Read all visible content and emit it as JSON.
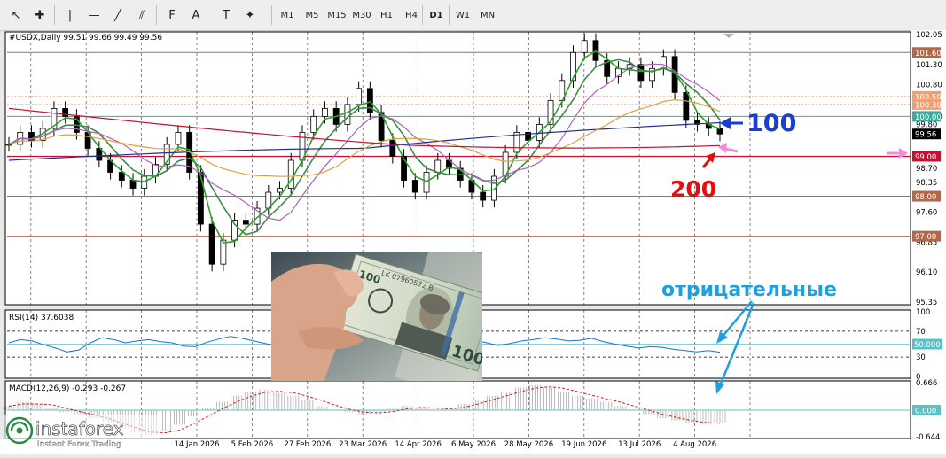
{
  "toolbar": {
    "tools": [
      {
        "name": "cursor-icon",
        "glyph": "↖"
      },
      {
        "name": "crosshair-icon",
        "glyph": "✚"
      },
      {
        "name": "vertical-line-icon",
        "glyph": "|"
      },
      {
        "name": "horizontal-line-icon",
        "glyph": "—"
      },
      {
        "name": "trendline-icon",
        "glyph": "╱"
      },
      {
        "name": "equidistant-channel-icon",
        "glyph": "⫽"
      },
      {
        "name": "fibonacci-icon",
        "glyph": "F"
      },
      {
        "name": "text-icon",
        "glyph": "A"
      },
      {
        "name": "text-label-icon",
        "glyph": "T"
      },
      {
        "name": "shapes-icon",
        "glyph": "✦"
      }
    ],
    "timeframes": [
      "M1",
      "M5",
      "M15",
      "M30",
      "H1",
      "H4",
      "D1",
      "W1",
      "MN"
    ]
  },
  "symbol_info": "#USDX,Daily  99.51 99.66 99.49 99.56",
  "rsi_title": "RSI(14) 37.6038",
  "macd_title": "MACD(12,26,9) -0.293 -0.267",
  "annotations": {
    "ma100": "100",
    "ma200": "200",
    "negative": "отрицательные"
  },
  "photo": {
    "bill_serial": "LK 07960572 B",
    "bill_denomination": "100"
  },
  "logo": {
    "name": "instaforex",
    "tagline": "Instant Forex Trading"
  },
  "chart_data": {
    "type": "line",
    "symbol": "#USDX",
    "timeframe": "Daily",
    "ohlc": {
      "open": 99.51,
      "high": 99.66,
      "low": 99.49,
      "close": 99.56
    },
    "ylim": [
      95.35,
      102.05
    ],
    "y_tick_labels": [
      "102.05",
      "101.30",
      "100.80",
      "100.00",
      "99.80",
      "98.70",
      "98.35",
      "97.60",
      "96.85",
      "96.10",
      "95.35"
    ],
    "price_badges": [
      {
        "label": "101.60",
        "value": 101.6,
        "color": "#b06848"
      },
      {
        "label": "100.50",
        "value": 100.5,
        "color": "#f0a070"
      },
      {
        "label": "100.30",
        "value": 100.3,
        "color": "#f0a070"
      },
      {
        "label": "100.00",
        "value": 100.0,
        "color": "#3caa9c"
      },
      {
        "label": "99.56",
        "value": 99.56,
        "color": "#000000"
      },
      {
        "label": "99.00",
        "value": 99.0,
        "color": "#c81030"
      },
      {
        "label": "98.00",
        "value": 98.0,
        "color": "#b06848"
      },
      {
        "label": "97.00",
        "value": 97.0,
        "color": "#b06848"
      }
    ],
    "x_tick_labels": [
      "14 Jan 2026",
      "5 Feb 2026",
      "27 Feb 2026",
      "23 Mar 2026",
      "14 Apr 2026",
      "6 May 2026",
      "28 May 2026",
      "19 Jun 2026",
      "13 Jul 2026",
      "4 Aug 2026"
    ],
    "price_series": [
      99.3,
      99.6,
      99.4,
      99.7,
      100.2,
      100.0,
      99.6,
      99.2,
      98.9,
      98.6,
      98.4,
      98.2,
      98.5,
      98.8,
      99.3,
      99.6,
      98.6,
      97.3,
      96.3,
      96.9,
      97.4,
      97.3,
      97.7,
      98.1,
      98.2,
      98.9,
      99.6,
      100.0,
      100.2,
      99.8,
      100.3,
      100.7,
      100.1,
      99.4,
      99.0,
      98.4,
      98.1,
      98.6,
      98.9,
      98.7,
      98.4,
      98.1,
      97.9,
      98.5,
      99.1,
      99.6,
      99.4,
      99.8,
      100.4,
      100.9,
      101.6,
      101.9,
      101.4,
      101.0,
      101.2,
      101.3,
      100.9,
      101.2,
      101.5,
      100.6,
      99.9,
      99.8,
      99.7,
      99.56
    ],
    "series": [
      {
        "name": "",
        "color": "#2ca02c",
        "period": 10
      },
      {
        "name": "",
        "color": "#3f8a4a",
        "period": 20
      },
      {
        "name": "",
        "color": "#b060c0",
        "period": 30
      },
      {
        "name": "",
        "color": "#1f2f8f",
        "period": 100
      },
      {
        "name": "",
        "color": "#e0a040",
        "period": 50
      },
      {
        "name": "",
        "color": "#c81030",
        "period": 200
      }
    ],
    "rsi": {
      "period": 14,
      "value": 37.6038,
      "ylim": [
        0,
        100
      ],
      "levels": [
        70,
        50,
        30
      ],
      "tick_labels": [
        "100",
        "70",
        "50.000",
        "30",
        "0"
      ],
      "series": [
        52,
        57,
        55,
        49,
        44,
        38,
        41,
        52,
        60,
        57,
        52,
        55,
        57,
        54,
        52,
        47,
        46,
        53,
        58,
        62,
        59,
        55,
        51,
        47,
        44,
        42,
        46,
        52,
        57,
        54,
        50,
        47,
        46,
        50,
        55,
        53,
        51,
        55,
        58,
        61,
        56,
        52,
        48,
        51,
        55,
        57,
        60,
        58,
        55,
        56,
        59,
        54,
        50,
        47,
        44,
        46,
        45,
        42,
        40,
        38,
        40,
        37.6
      ]
    },
    "macd": {
      "fast": 12,
      "slow": 26,
      "signal": 9,
      "main": -0.293,
      "signal_value": -0.267,
      "ylim": [
        -0.644,
        0.666
      ],
      "tick_labels": [
        "0.666",
        "0.000",
        "-0.644"
      ],
      "histogram": [
        0.1,
        0.2,
        0.15,
        0.05,
        -0.05,
        -0.1,
        -0.2,
        -0.3,
        -0.45,
        -0.55,
        -0.6,
        -0.5,
        -0.35,
        -0.15,
        0.05,
        0.2,
        0.35,
        0.45,
        0.5,
        0.42,
        0.35,
        0.25,
        0.1,
        0.0,
        -0.05,
        -0.1,
        -0.05,
        0.05,
        0.1,
        0.05,
        0.0,
        0.05,
        0.15,
        0.25,
        0.35,
        0.45,
        0.55,
        0.6,
        0.55,
        0.45,
        0.35,
        0.28,
        0.2,
        0.1,
        0.0,
        -0.1,
        -0.2,
        -0.25,
        -0.3,
        -0.35,
        -0.3
      ]
    }
  }
}
